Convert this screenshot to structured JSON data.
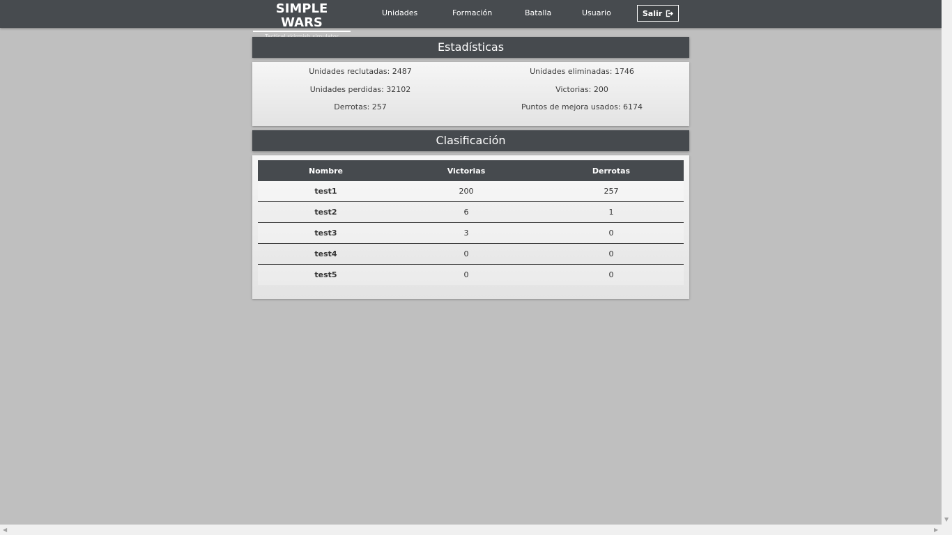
{
  "nav": {
    "logo_title": "SIMPLE WARS",
    "logo_subtitle": "Tactical skirmish simulator",
    "links": [
      "Unidades",
      "Formación",
      "Batalla",
      "Usuario"
    ],
    "logout_label": "Salir",
    "logout_icon": "logout-icon"
  },
  "stats": {
    "title": "Estadísticas",
    "items": [
      "Unidades reclutadas: 2487",
      "Unidades eliminadas: 1746",
      "Unidades perdidas: 32102",
      "Victorias: 200",
      "Derrotas: 257",
      "Puntos de mejora usados: 6174"
    ]
  },
  "ranking": {
    "title": "Clasificación",
    "columns": [
      "Nombre",
      "Victorias",
      "Derrotas"
    ],
    "rows": [
      [
        "test1",
        "200",
        "257"
      ],
      [
        "test2",
        "6",
        "1"
      ],
      [
        "test3",
        "3",
        "0"
      ],
      [
        "test4",
        "0",
        "0"
      ],
      [
        "test5",
        "0",
        "0"
      ]
    ]
  },
  "colors": {
    "background": "#bfbfbf",
    "navbar": "#474b4f",
    "panel_header": "#464a4e"
  }
}
